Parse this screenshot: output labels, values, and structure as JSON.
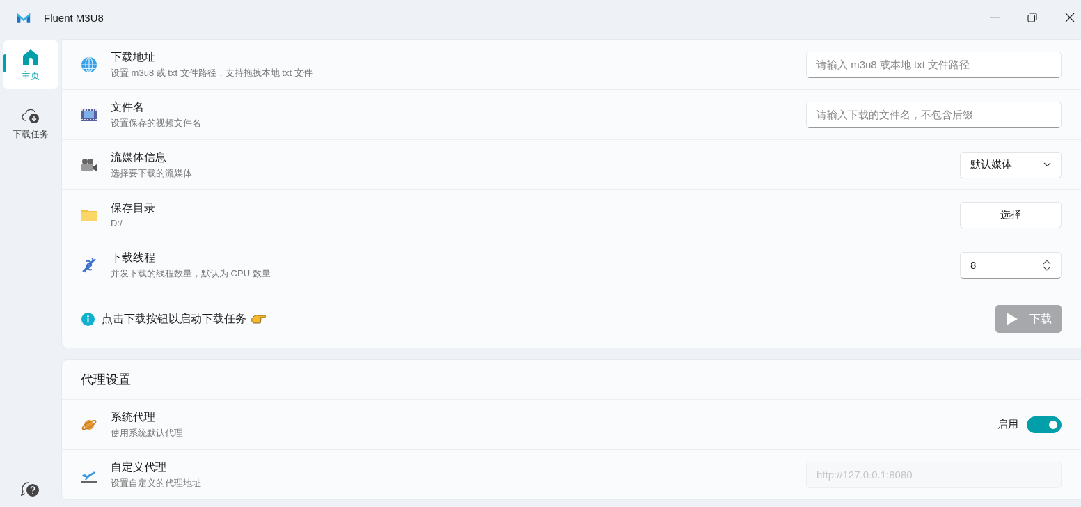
{
  "window": {
    "title": "Fluent M3U8"
  },
  "nav": [
    {
      "label": "主页",
      "selected": true
    },
    {
      "label": "下载任务",
      "selected": false
    }
  ],
  "download_settings": {
    "rows": [
      {
        "kind": "input",
        "title": "下载地址",
        "description": "设置 m3u8 或 txt 文件路径，支持拖拽本地 txt 文件",
        "placeholder": "请输入 m3u8 或本地 txt 文件路径",
        "disabled": false
      },
      {
        "kind": "input",
        "title": "文件名",
        "description": "设置保存的视频文件名",
        "placeholder": "请输入下载的文件名，不包含后缀",
        "disabled": false
      },
      {
        "kind": "dropdown",
        "title": "流媒体信息",
        "description": "选择要下载的流媒体",
        "value": "默认媒体"
      },
      {
        "kind": "button",
        "title": "保存目录",
        "description": "D:/",
        "button": "选择"
      },
      {
        "kind": "spinbox",
        "title": "下载线程",
        "description": "并发下载的线程数量，默认为 CPU 数量",
        "value": "8"
      }
    ],
    "hint": "点击下载按钮以启动下载任务",
    "download_button": {
      "label": "下载",
      "disabled": true
    }
  },
  "proxy_settings": {
    "title": "代理设置",
    "rows": [
      {
        "kind": "switch",
        "title": "系统代理",
        "description": "使用系统默认代理",
        "switch_label": "启用",
        "on": true
      },
      {
        "kind": "input",
        "title": "自定义代理",
        "description": "设置自定义的代理地址",
        "placeholder": "http://127.0.0.1:8080",
        "disabled": true
      }
    ]
  }
}
